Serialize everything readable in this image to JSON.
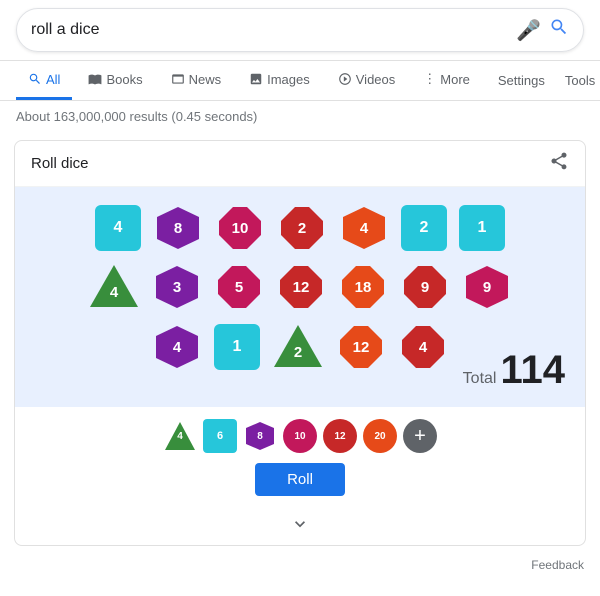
{
  "search": {
    "query": "roll a dice",
    "mic_icon": "🎤",
    "search_icon": "🔍"
  },
  "nav": {
    "tabs": [
      {
        "label": "All",
        "icon": "🔍",
        "active": true,
        "type": "all"
      },
      {
        "label": "Books",
        "icon": "📖",
        "type": "books"
      },
      {
        "label": "News",
        "icon": "📰",
        "type": "news"
      },
      {
        "label": "Images",
        "icon": "🖼",
        "type": "images"
      },
      {
        "label": "Videos",
        "icon": "▶",
        "type": "videos"
      },
      {
        "label": "More",
        "icon": "⋮",
        "type": "more"
      }
    ],
    "settings": "Settings",
    "tools": "Tools"
  },
  "results": {
    "count_text": "About 163,000,000 results (0.45 seconds)"
  },
  "dice_card": {
    "title": "Roll dice",
    "share_icon": "share",
    "total_label": "Total",
    "total_value": "114",
    "roll_btn": "Roll",
    "feedback": "Feedback",
    "dice_rows": [
      [
        {
          "shape": "square",
          "value": "4",
          "color": "#26c6da"
        },
        {
          "shape": "hex",
          "value": "8",
          "color": "#7b1fa2"
        },
        {
          "shape": "oct",
          "value": "10",
          "color": "#c2185b"
        },
        {
          "shape": "oct",
          "value": "2",
          "color": "#c62828"
        },
        {
          "shape": "hex",
          "value": "4",
          "color": "#e64a19"
        },
        {
          "shape": "square",
          "value": "2",
          "color": "#26c6da"
        },
        {
          "shape": "square",
          "value": "1",
          "color": "#26c6da"
        }
      ],
      [
        {
          "shape": "triangle",
          "value": "4",
          "color": "#388e3c"
        },
        {
          "shape": "hex",
          "value": "3",
          "color": "#7b1fa2"
        },
        {
          "shape": "oct",
          "value": "5",
          "color": "#c2185b"
        },
        {
          "shape": "oct",
          "value": "12",
          "color": "#c62828"
        },
        {
          "shape": "oct",
          "value": "18",
          "color": "#e64a19"
        },
        {
          "shape": "oct",
          "value": "9",
          "color": "#c62828"
        },
        {
          "shape": "diamond",
          "value": "9",
          "color": "#c2185b"
        }
      ],
      [
        {
          "shape": "hex",
          "value": "4",
          "color": "#7b1fa2"
        },
        {
          "shape": "square",
          "value": "1",
          "color": "#26c6da"
        },
        {
          "shape": "triangle",
          "value": "2",
          "color": "#388e3c"
        },
        {
          "shape": "oct",
          "value": "12",
          "color": "#e64a19"
        },
        {
          "shape": "oct",
          "value": "4",
          "color": "#c62828"
        }
      ]
    ],
    "type_buttons": [
      {
        "label": "4",
        "color": "#388e3c",
        "shape": "triangle"
      },
      {
        "label": "6",
        "color": "#26c6da",
        "shape": "square"
      },
      {
        "label": "8",
        "color": "#7b1fa2",
        "shape": "hex"
      },
      {
        "label": "10",
        "color": "#c2185b",
        "shape": "circle"
      },
      {
        "label": "12",
        "color": "#c62828",
        "shape": "circle"
      },
      {
        "label": "20",
        "color": "#e64a19",
        "shape": "circle"
      }
    ]
  }
}
